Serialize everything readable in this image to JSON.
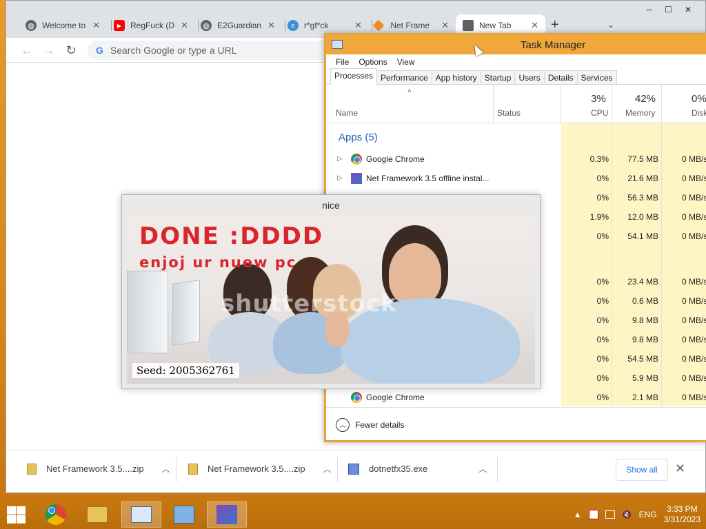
{
  "chrome": {
    "tabs": [
      {
        "label": "Welcome to",
        "icon": "globe-icon"
      },
      {
        "label": "RegFuck (D",
        "icon": "youtube-icon"
      },
      {
        "label": "E2Guardian",
        "icon": "globe-icon"
      },
      {
        "label": "r*gf*ck",
        "icon": "edge-icon"
      },
      {
        "label": ".Net Frame",
        "icon": "diamond-icon"
      },
      {
        "label": "New Tab",
        "icon": "newtab-icon"
      }
    ],
    "new_tab_glyph": "+",
    "omnibox_placeholder": "Search Google or type a URL",
    "downloads": [
      {
        "name": "Net Framework 3.5....zip"
      },
      {
        "name": "Net Framework 3.5....zip"
      },
      {
        "name": "dotnetfx35.exe"
      }
    ],
    "show_all_label": "Show all"
  },
  "taskmanager": {
    "title": "Task Manager",
    "menu": [
      "File",
      "Options",
      "View"
    ],
    "tabs": [
      "Processes",
      "Performance",
      "App history",
      "Startup",
      "Users",
      "Details",
      "Services"
    ],
    "columns": {
      "name": "Name",
      "status": "Status",
      "cpu_label": "CPU",
      "cpu_pct": "3%",
      "memory_label": "Memory",
      "memory_pct": "42%",
      "disk_label": "Disk",
      "disk_pct": "0%"
    },
    "group_label": "Apps (5)",
    "rows": [
      {
        "name": "Google Chrome",
        "cpu": "0.3%",
        "memory": "77.5 MB",
        "disk": "0 MB/s"
      },
      {
        "name": "Net Framework 3.5 offline instal...",
        "cpu": "0%",
        "memory": "21.6 MB",
        "disk": "0 MB/s"
      },
      {
        "name": "",
        "cpu": "0%",
        "memory": "56.3 MB",
        "disk": "0 MB/s"
      },
      {
        "name": "",
        "cpu": "1.9%",
        "memory": "12.0 MB",
        "disk": "0 MB/s"
      },
      {
        "name": "",
        "cpu": "0%",
        "memory": "54.1 MB",
        "disk": "0 MB/s"
      },
      {
        "name": "",
        "cpu": "0%",
        "memory": "23.4 MB",
        "disk": "0 MB/s"
      },
      {
        "name": "",
        "cpu": "0%",
        "memory": "0.6 MB",
        "disk": "0 MB/s"
      },
      {
        "name": "",
        "cpu": "0%",
        "memory": "9.8 MB",
        "disk": "0 MB/s"
      },
      {
        "name": "",
        "cpu": "0%",
        "memory": "9.8 MB",
        "disk": "0 MB/s"
      },
      {
        "name": "",
        "cpu": "0%",
        "memory": "54.5 MB",
        "disk": "0 MB/s"
      },
      {
        "name": "",
        "cpu": "0%",
        "memory": "5.9 MB",
        "disk": "0 MB/s"
      },
      {
        "name": "Google Chrome",
        "cpu": "0%",
        "memory": "2.1 MB",
        "disk": "0 MB/s"
      }
    ],
    "fewer_details_label": "Fewer details"
  },
  "nice_window": {
    "title": "nice",
    "done_text": "DONE :DDDD",
    "enjoy_text": "enjoj ur nuew pc",
    "watermark_text": "shutterstock",
    "seed_text": "Seed: 2005362761"
  },
  "taskbar": {
    "language": "ENG",
    "time": "3:33 PM",
    "date": "3/31/2023"
  },
  "colors": {
    "accent_orange": "#f0a83a",
    "tm_highlight": "#fff4c4",
    "link_blue": "#1a73e8",
    "done_red": "#d8262b"
  }
}
